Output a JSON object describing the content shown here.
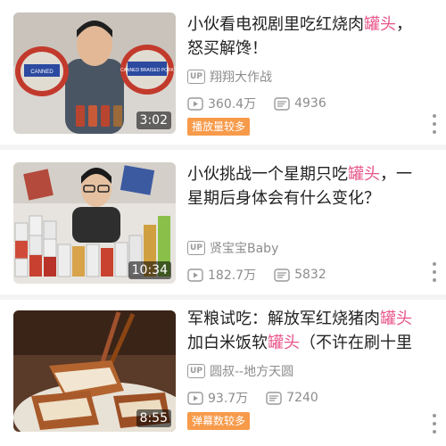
{
  "feed": {
    "videos": [
      {
        "title_parts": [
          "小伙看电视剧里吃红烧肉",
          "罐头",
          "，怒买解馋！"
        ],
        "uploader_badge": "UP",
        "uploader": "翔翔大作战",
        "views": "360.4万",
        "danmaku": "4936",
        "duration": "3:02",
        "tag": "播放量较多",
        "thumbnail_labels": [
          "CANNED",
          "CANNED BRAISED PORK"
        ]
      },
      {
        "title_parts": [
          "小伙挑战一个星期只吃",
          "罐头",
          "，一星期后身体会有什么变化？"
        ],
        "uploader_badge": "UP",
        "uploader": "贤宝宝Baby",
        "views": "182.7万",
        "danmaku": "5832",
        "duration": "10:34"
      },
      {
        "title_parts": [
          "军粮试吃：解放军红烧猪肉",
          "罐头",
          "加白米饭软",
          "罐头",
          "（不许在刷十里春风的…"
        ],
        "uploader_badge": "UP",
        "uploader": "圆叔--地方天圆",
        "views": "93.7万",
        "danmaku": "7240",
        "duration": "8:55",
        "tag": "弹幕数较多"
      }
    ]
  },
  "colors": {
    "highlight": "#e8558a",
    "tag_bg": "#f79a4a",
    "meta": "#8c8c8c"
  },
  "icons": [
    "play-count-icon",
    "danmaku-icon",
    "more-options-icon",
    "up-badge-icon"
  ]
}
